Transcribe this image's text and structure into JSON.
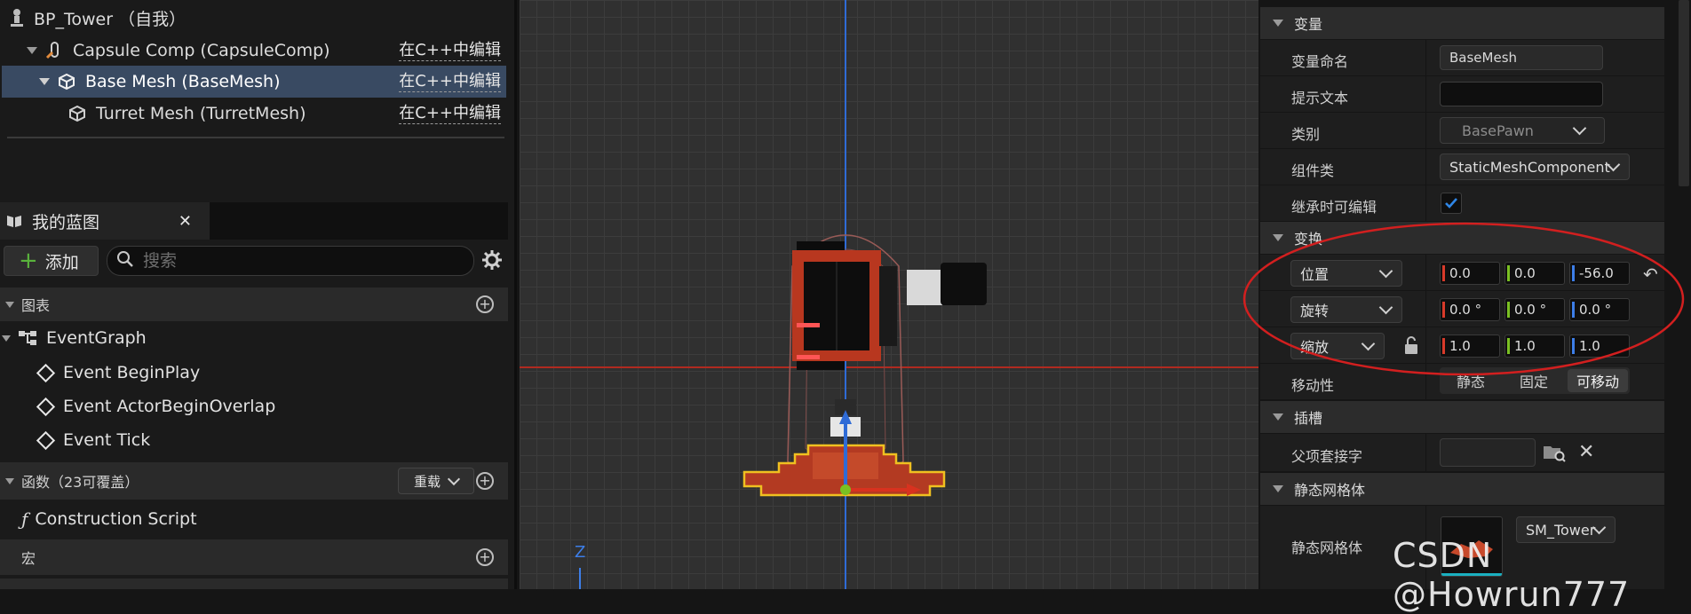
{
  "components": {
    "root": "BP_Tower （自我）",
    "items": [
      {
        "label": "Capsule Comp (CapsuleComp)",
        "edit": "在C++中编辑"
      },
      {
        "label": "Base Mesh (BaseMesh)",
        "edit": "在C++中编辑"
      },
      {
        "label": "Turret Mesh (TurretMesh)",
        "edit": "在C++中编辑"
      }
    ]
  },
  "my_blueprint": {
    "tab_label": "我的蓝图",
    "add_label": "添加",
    "search_placeholder": "搜索",
    "graphs_label": "图表",
    "event_graph": "EventGraph",
    "events": [
      "Event BeginPlay",
      "Event ActorBeginOverlap",
      "Event Tick"
    ],
    "functions_label": "函数（23可覆盖）",
    "override_label": "重载",
    "construction_script": "Construction Script",
    "macros_label": "宏"
  },
  "viewport": {
    "axis_label": "Z"
  },
  "details": {
    "variable_section": "变量",
    "variable_name_label": "变量命名",
    "variable_name_value": "BaseMesh",
    "tooltip_label": "提示文本",
    "tooltip_value": "",
    "category_label": "类别",
    "category_value": "BasePawn",
    "component_class_label": "组件类",
    "component_class_value": "StaticMeshComponent",
    "editable_inherit_label": "继承时可编辑",
    "transform_section": "变换",
    "location_label": "位置",
    "location": [
      "0.0",
      "0.0",
      "-56.0"
    ],
    "rotation_label": "旋转",
    "rotation": [
      "0.0 °",
      "0.0 °",
      "0.0 °"
    ],
    "scale_label": "缩放",
    "scale": [
      "1.0",
      "1.0",
      "1.0"
    ],
    "mobility_label": "移动性",
    "mobility_options": [
      "静态",
      "固定",
      "可移动"
    ],
    "sockets_section": "插槽",
    "parent_socket_label": "父项套接字",
    "static_mesh_section": "静态网格体",
    "static_mesh_label": "静态网格体",
    "static_mesh_value": "SM_Tower"
  },
  "watermark": "CSDN @Howrun777",
  "colors": {
    "selection": "#394a62",
    "annotation_ring": "#d21f1f",
    "accent_blue": "#1d6fd9"
  }
}
